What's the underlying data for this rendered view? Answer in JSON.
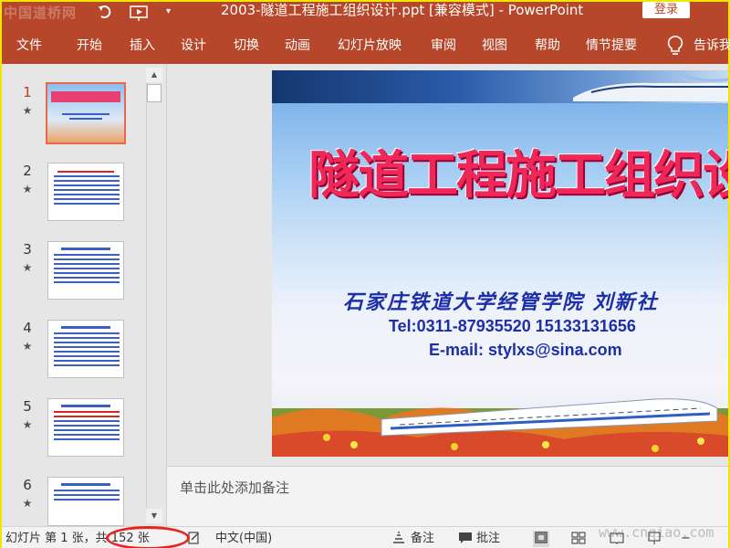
{
  "window": {
    "title": "2003-隧道工程施工组织设计.ppt [兼容模式] - PowerPoint",
    "login_label": "登录",
    "watermark_logo": "中国道桥网",
    "brand_color": "#b7472a"
  },
  "ribbon": {
    "tabs": [
      "文件",
      "开始",
      "插入",
      "设计",
      "切换",
      "动画",
      "幻灯片放映",
      "审阅",
      "视图",
      "帮助",
      "情节提要"
    ],
    "tell_me": "告诉我"
  },
  "thumbnails": [
    {
      "number": "1",
      "star": "★",
      "active": true
    },
    {
      "number": "2",
      "star": "★",
      "active": false
    },
    {
      "number": "3",
      "star": "★",
      "active": false
    },
    {
      "number": "4",
      "star": "★",
      "active": false
    },
    {
      "number": "5",
      "star": "★",
      "active": false
    },
    {
      "number": "6",
      "star": "★",
      "active": false
    }
  ],
  "slide": {
    "title": "隧道工程施工组织设计",
    "author": "石家庄铁道大学经管学院  刘新社",
    "tel": "Tel:0311-87935520  15133131656",
    "email": "E-mail: stylxs@sina.com"
  },
  "notes": {
    "placeholder": "单击此处添加备注"
  },
  "statusbar": {
    "slide_info": "幻灯片 第 1 张，共 152 张",
    "language": "中文(中国)",
    "notes_label": "备注",
    "comments_label": "批注",
    "watermark": "www.cnqiao.com"
  }
}
